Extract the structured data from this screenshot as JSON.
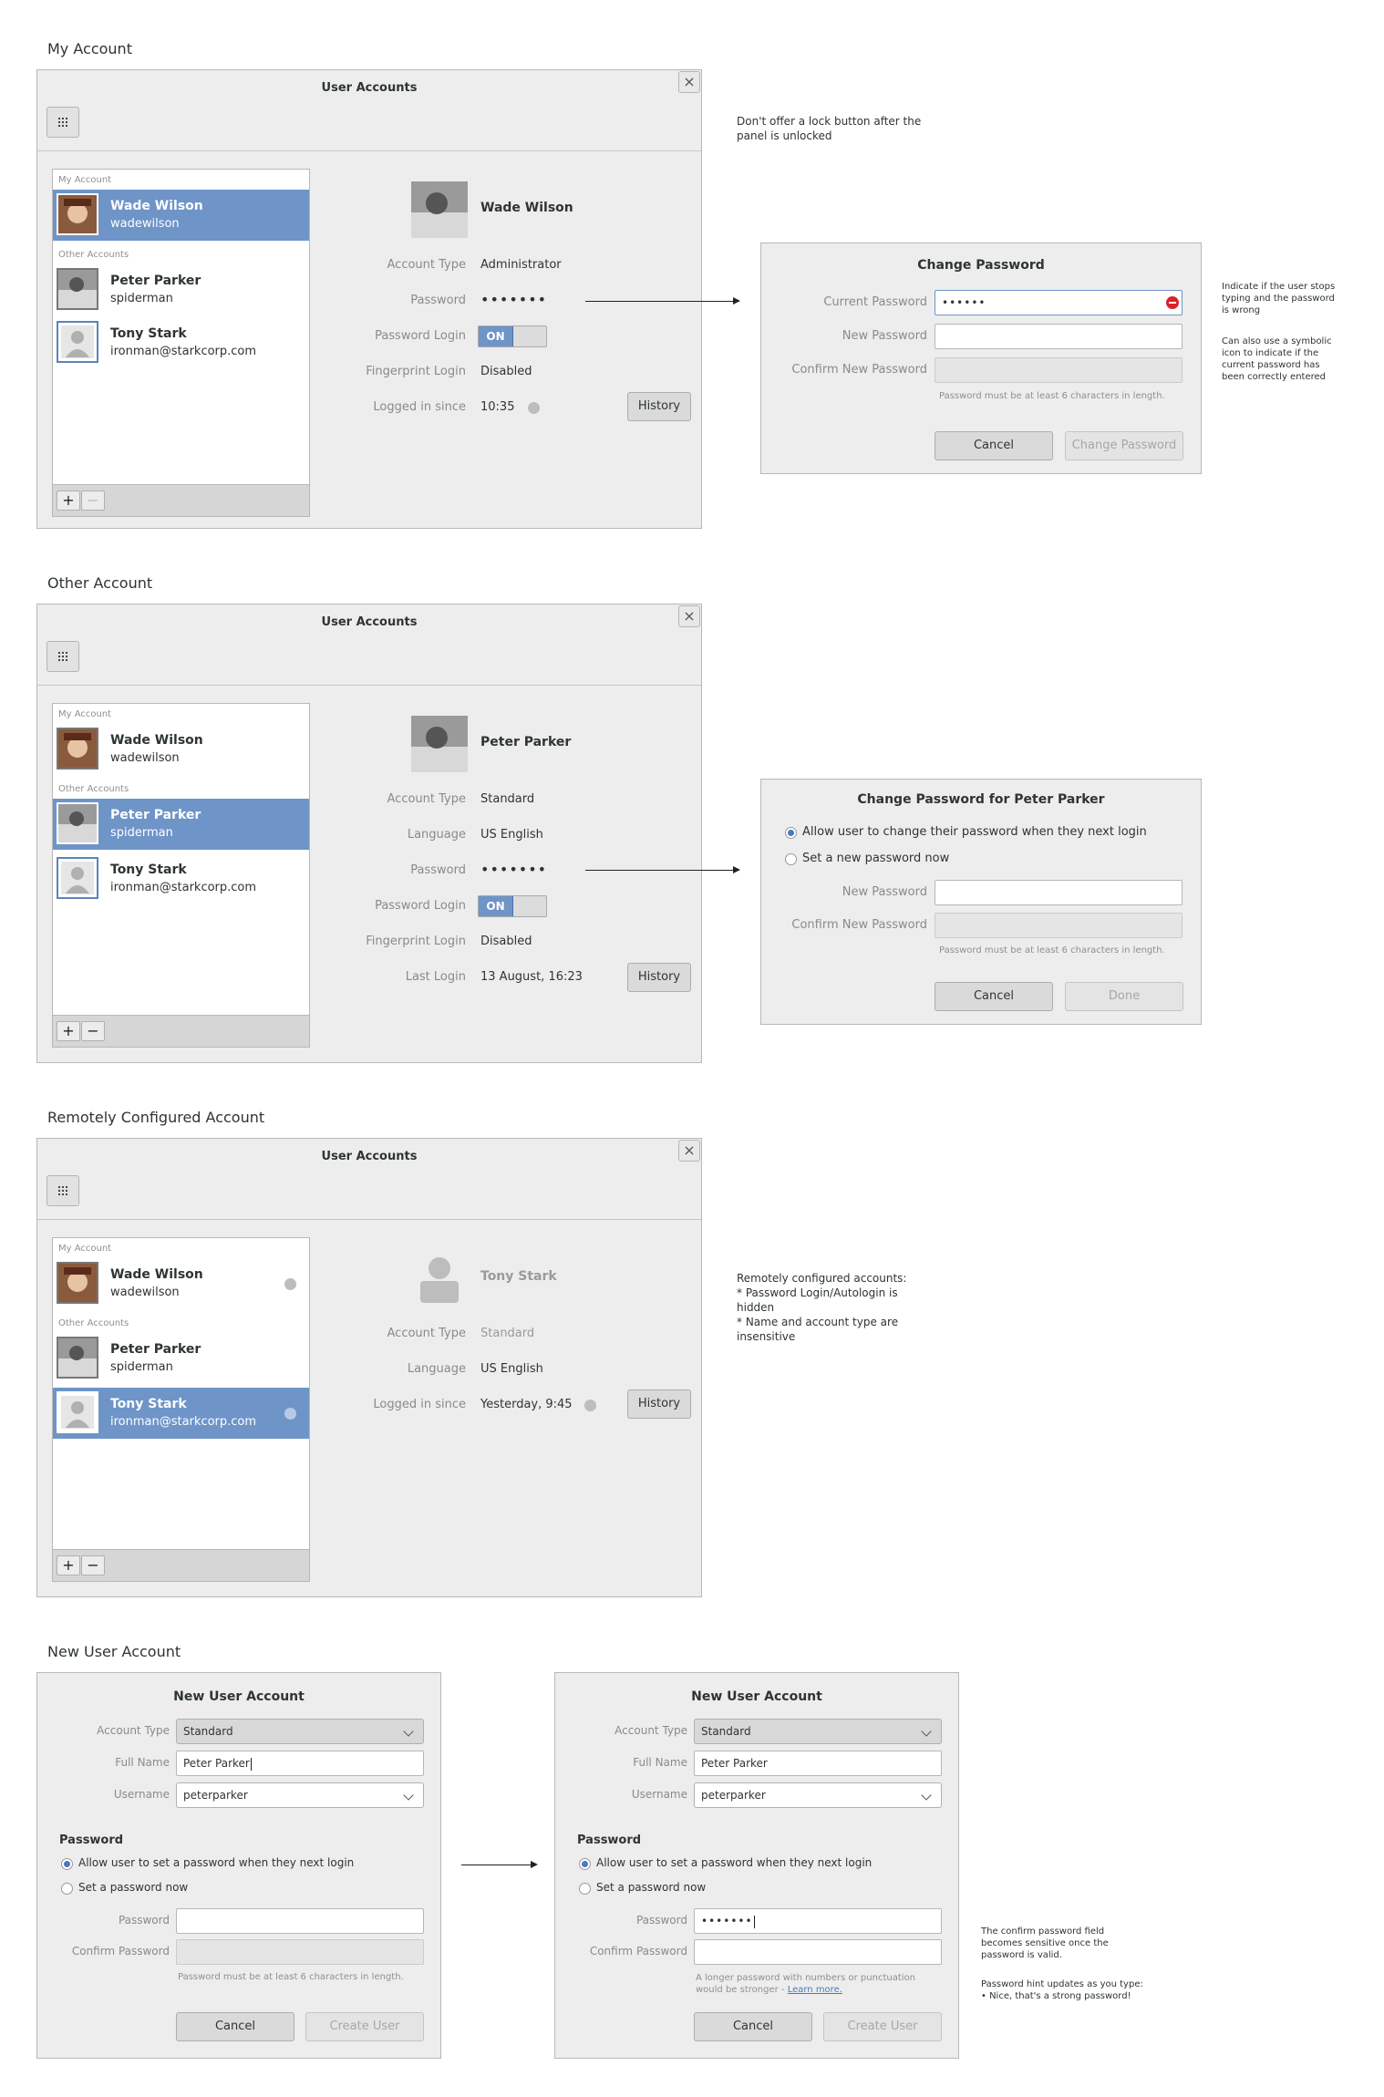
{
  "sections": {
    "my_account": "My Account",
    "other_account": "Other Account",
    "remote_account": "Remotely Configured Account",
    "new_user_account": "New User Account"
  },
  "window_title": "User Accounts",
  "list_groups": {
    "mine": "My Account",
    "others": "Other Accounts"
  },
  "users": [
    {
      "name": "Wade Wilson",
      "login": "wadewilson"
    },
    {
      "name": "Peter Parker",
      "login": "spiderman"
    },
    {
      "name": "Tony Stark",
      "login": "ironman@starkcorp.com"
    }
  ],
  "labels": {
    "account_type": "Account Type",
    "password": "Password",
    "password_login": "Password Login",
    "fingerprint_login": "Fingerprint Login",
    "logged_in_since": "Logged in since",
    "language": "Language",
    "last_login": "Last Login",
    "history": "History",
    "on": "ON"
  },
  "panel1": {
    "account_type": "Administrator",
    "password": "•••••••",
    "fingerprint": "Disabled",
    "logged_in_since": "10:35"
  },
  "panel2": {
    "account_type": "Standard",
    "language": "US English",
    "password": "•••••••",
    "fingerprint": "Disabled",
    "last_login": "13 August, 16:23"
  },
  "panel3": {
    "account_type": "Standard",
    "language": "US English",
    "logged_in_since": "Yesterday, 9:45"
  },
  "notes": {
    "lock": "Don't offer a lock button after the panel is unlocked",
    "wrong_pw": "Indicate if the user stops typing and the password is wrong",
    "symbolic": "Can also use a symbolic icon to indicate if the current password has been correctly entered",
    "remote_head": "Remotely configured accounts:",
    "remote_1": " * Password Login/Autologin is hidden",
    "remote_2": " * Name and account type are insensitive",
    "confirm_sensitive": "The confirm password field becomes sensitive once the password is valid.",
    "hint_updates": "Password hint updates as you type:",
    "hint_example": "• Nice, that's a strong password!"
  },
  "change_password": {
    "title": "Change Password",
    "current": "Current Password",
    "current_value": "••••••",
    "new": "New Password",
    "confirm": "Confirm New Password",
    "hint": "Password must be at least 6 characters in length.",
    "cancel": "Cancel",
    "submit": "Change Password"
  },
  "change_password_other": {
    "title": "Change Password for Peter Parker",
    "opt_next_login": "Allow user to change their password when they next login",
    "opt_set_now": "Set a new password now",
    "new": "New Password",
    "confirm": "Confirm New Password",
    "hint": "Password must be at least 6 characters in length.",
    "cancel": "Cancel",
    "done": "Done"
  },
  "new_user": {
    "title": "New User Account",
    "account_type_label": "Account Type",
    "account_type": "Standard",
    "full_name_label": "Full Name",
    "full_name": "Peter Parker",
    "username_label": "Username",
    "username": "peterparker",
    "password_heading": "Password",
    "opt_next_login": "Allow user to set a password when they next login",
    "opt_set_now": "Set a password now",
    "password_label": "Password",
    "confirm_label": "Confirm Password",
    "hint": "Password must be at least 6 characters in length.",
    "password_value": "•••••••",
    "hint2_line1": "A longer password with numbers or punctuation",
    "hint2_line2": "would be stronger -",
    "learn_more": "Learn more.",
    "cancel": "Cancel",
    "create": "Create User"
  },
  "colors": {
    "selection": "#6e94c8",
    "error": "#d9232c",
    "background": "#ededed"
  },
  "icons": [
    "grid-icon",
    "close-icon",
    "add-icon",
    "remove-icon",
    "check-icon",
    "error-icon",
    "chevron-down-icon",
    "arrow-right-icon"
  ]
}
